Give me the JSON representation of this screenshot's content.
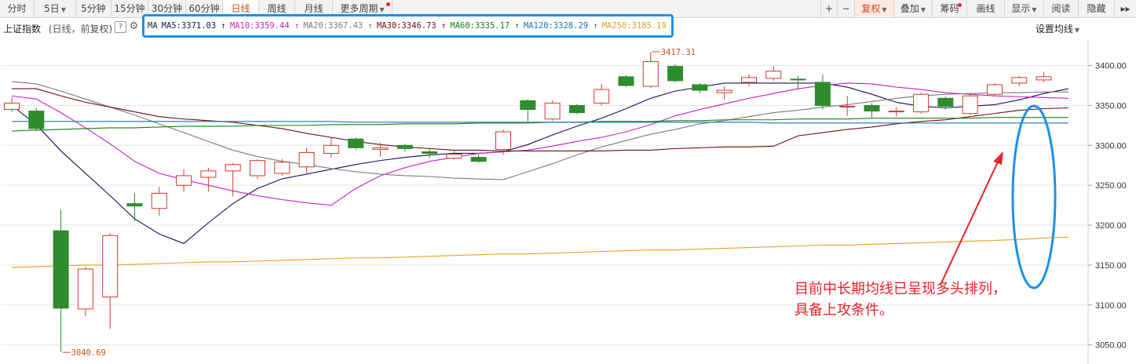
{
  "toolbar": {
    "left_tabs": [
      "分时",
      "5日",
      "5分钟",
      "15分钟",
      "30分钟",
      "60分钟",
      "日线",
      "周线",
      "月线",
      "更多周期"
    ],
    "active_tab": "日线",
    "right_tabs": [
      "复权",
      "叠加",
      "筹码",
      "画线",
      "显示",
      "阅读",
      "隐藏"
    ],
    "plus": "+",
    "minus": "−",
    "forward": "▸▸",
    "dot_color": "#e8222a"
  },
  "header": {
    "title": "上证指数",
    "subtitle": "(日线，前复权)",
    "help_icon": "?",
    "settings_icon": "gear-icon",
    "set_ma_label": "设置均线"
  },
  "ma_legend": {
    "prefix": "MA",
    "items": [
      {
        "label": "MA5:3371.03",
        "arrow": "↑",
        "color": "#14145c"
      },
      {
        "label": "MA10:3359.44",
        "arrow": "↑",
        "color": "#c81ec8"
      },
      {
        "label": "MA20:3367.43",
        "arrow": "↑",
        "color": "#7a7a7a"
      },
      {
        "label": "MA30:3346.73",
        "arrow": "↑",
        "color": "#6e0a14"
      },
      {
        "label": "MA60:3335.17",
        "arrow": "↑",
        "color": "#1a7d1a"
      },
      {
        "label": "MA120:3328.29",
        "arrow": "↑",
        "color": "#1478b4"
      },
      {
        "label": "MA250:3185.19",
        "arrow": "↑",
        "color": "#e8a01e"
      }
    ]
  },
  "annotation": {
    "line1": "目前中长期均线已呈现多头排列，",
    "line2": "具备上攻条件。",
    "color": "#e8222a"
  },
  "chart_data": {
    "type": "candlestick",
    "ylim": [
      3030,
      3433
    ],
    "yticks": [
      "3400.00",
      "3350.00",
      "3300.00",
      "3250.00",
      "3200.00",
      "3150.00",
      "3100.00",
      "3050.00"
    ],
    "grid": true,
    "up_color": "#d43a2e",
    "down_color": "#2e8b2e",
    "candles": [
      {
        "o": 3345,
        "c": 3353,
        "h": 3360,
        "l": 3342
      },
      {
        "o": 3343,
        "c": 3321,
        "h": 3347,
        "l": 3318
      },
      {
        "o": 3193,
        "c": 3096,
        "h": 3219,
        "l": 3041
      },
      {
        "o": 3095,
        "c": 3145,
        "h": 3148,
        "l": 3086
      },
      {
        "o": 3110,
        "c": 3187,
        "h": 3190,
        "l": 3070
      },
      {
        "o": 3227,
        "c": 3224,
        "h": 3240,
        "l": 3205
      },
      {
        "o": 3221,
        "c": 3240,
        "h": 3248,
        "l": 3212
      },
      {
        "o": 3250,
        "c": 3262,
        "h": 3270,
        "l": 3242
      },
      {
        "o": 3260,
        "c": 3268,
        "h": 3272,
        "l": 3242
      },
      {
        "o": 3268,
        "c": 3276,
        "h": 3278,
        "l": 3236
      },
      {
        "o": 3262,
        "c": 3281,
        "h": 3283,
        "l": 3258
      },
      {
        "o": 3265,
        "c": 3279,
        "h": 3283,
        "l": 3262
      },
      {
        "o": 3273,
        "c": 3291,
        "h": 3297,
        "l": 3265
      },
      {
        "o": 3290,
        "c": 3300,
        "h": 3310,
        "l": 3285
      },
      {
        "o": 3308,
        "c": 3297,
        "h": 3310,
        "l": 3294
      },
      {
        "o": 3295,
        "c": 3297,
        "h": 3303,
        "l": 3286
      },
      {
        "o": 3300,
        "c": 3296,
        "h": 3302,
        "l": 3292
      },
      {
        "o": 3292,
        "c": 3290,
        "h": 3296,
        "l": 3284
      },
      {
        "o": 3284,
        "c": 3289,
        "h": 3293,
        "l": 3282
      },
      {
        "o": 3285,
        "c": 3280,
        "h": 3290,
        "l": 3278
      },
      {
        "o": 3295,
        "c": 3317,
        "h": 3320,
        "l": 3288
      },
      {
        "o": 3356,
        "c": 3345,
        "h": 3358,
        "l": 3330
      },
      {
        "o": 3333,
        "c": 3353,
        "h": 3356,
        "l": 3331
      },
      {
        "o": 3350,
        "c": 3341,
        "h": 3352,
        "l": 3339
      },
      {
        "o": 3353,
        "c": 3370,
        "h": 3377,
        "l": 3350
      },
      {
        "o": 3386,
        "c": 3375,
        "h": 3388,
        "l": 3373
      },
      {
        "o": 3374,
        "c": 3405,
        "h": 3417,
        "l": 3372
      },
      {
        "o": 3399,
        "c": 3381,
        "h": 3402,
        "l": 3379
      },
      {
        "o": 3376,
        "c": 3369,
        "h": 3378,
        "l": 3365
      },
      {
        "o": 3366,
        "c": 3369,
        "h": 3374,
        "l": 3357
      },
      {
        "o": 3379,
        "c": 3385,
        "h": 3389,
        "l": 3374
      },
      {
        "o": 3384,
        "c": 3393,
        "h": 3399,
        "l": 3381
      },
      {
        "o": 3383,
        "c": 3382,
        "h": 3387,
        "l": 3370
      },
      {
        "o": 3379,
        "c": 3350,
        "h": 3389,
        "l": 3345
      },
      {
        "o": 3348,
        "c": 3349,
        "h": 3362,
        "l": 3337
      },
      {
        "o": 3350,
        "c": 3343,
        "h": 3353,
        "l": 3335
      },
      {
        "o": 3342,
        "c": 3343,
        "h": 3348,
        "l": 3336
      },
      {
        "o": 3342,
        "c": 3364,
        "h": 3366,
        "l": 3340
      },
      {
        "o": 3359,
        "c": 3349,
        "h": 3361,
        "l": 3345
      },
      {
        "o": 3340,
        "c": 3362,
        "h": 3364,
        "l": 3338
      },
      {
        "o": 3364,
        "c": 3376,
        "h": 3378,
        "l": 3362
      },
      {
        "o": 3378,
        "c": 3385,
        "h": 3387,
        "l": 3374
      },
      {
        "o": 3382,
        "c": 3386,
        "h": 3392,
        "l": 3379
      }
    ],
    "price_labels": [
      {
        "text": "3417.31",
        "index": 26,
        "value": 3417.31
      },
      {
        "text": "3040.69",
        "index": 2,
        "value": 3040.69
      }
    ],
    "series": [
      {
        "name": "MA5",
        "color": "#14145c",
        "values": [
          3350,
          3326,
          3293,
          3265,
          3237,
          3208,
          3189,
          3177,
          3203,
          3227,
          3246,
          3258,
          3264,
          3270,
          3276,
          3281,
          3285,
          3288,
          3290,
          3290,
          3292,
          3301,
          3313,
          3324,
          3334,
          3346,
          3359,
          3368,
          3373,
          3378,
          3378,
          3378,
          3378,
          3378,
          3373,
          3364,
          3354,
          3349,
          3347,
          3349,
          3351,
          3357,
          3365,
          3371
        ]
      },
      {
        "name": "MA10",
        "color": "#c81ec8",
        "values": [
          3362,
          3358,
          3341,
          3322,
          3302,
          3280,
          3265,
          3257,
          3250,
          3243,
          3237,
          3232,
          3228,
          3225,
          3246,
          3262,
          3272,
          3280,
          3285,
          3290,
          3292,
          3294,
          3299,
          3305,
          3310,
          3317,
          3326,
          3337,
          3345,
          3352,
          3359,
          3365,
          3371,
          3375,
          3378,
          3377,
          3373,
          3370,
          3366,
          3364,
          3362,
          3361,
          3360,
          3359
        ]
      },
      {
        "name": "MA20",
        "color": "#7a7a7a",
        "values": [
          3380,
          3377,
          3368,
          3358,
          3348,
          3338,
          3327,
          3316,
          3305,
          3294,
          3286,
          3280,
          3276,
          3271,
          3267,
          3264,
          3262,
          3261,
          3259,
          3258,
          3257,
          3267,
          3277,
          3288,
          3298,
          3306,
          3314,
          3320,
          3327,
          3331,
          3336,
          3341,
          3344,
          3348,
          3351,
          3355,
          3359,
          3362,
          3364,
          3365,
          3366,
          3366,
          3367,
          3367
        ]
      },
      {
        "name": "MA30",
        "color": "#6e0a14",
        "values": [
          3371,
          3371,
          3362,
          3354,
          3348,
          3342,
          3336,
          3333,
          3331,
          3329,
          3325,
          3321,
          3315,
          3310,
          3305,
          3301,
          3298,
          3296,
          3294,
          3294,
          3293,
          3293,
          3293,
          3293,
          3293,
          3294,
          3294,
          3296,
          3297,
          3298,
          3298,
          3299,
          3312,
          3316,
          3320,
          3323,
          3327,
          3330,
          3332,
          3336,
          3340,
          3344,
          3346,
          3347
        ]
      },
      {
        "name": "MA60",
        "color": "#1a7d1a",
        "values": [
          3318,
          3319,
          3320,
          3321,
          3322,
          3322,
          3323,
          3324,
          3324,
          3324,
          3325,
          3325,
          3325,
          3326,
          3326,
          3326,
          3327,
          3327,
          3327,
          3328,
          3328,
          3328,
          3329,
          3329,
          3330,
          3330,
          3330,
          3331,
          3331,
          3332,
          3332,
          3332,
          3333,
          3333,
          3333,
          3334,
          3334,
          3334,
          3334,
          3334,
          3335,
          3335,
          3335,
          3335
        ]
      },
      {
        "name": "MA120",
        "color": "#1478b4",
        "values": [
          3330,
          3330,
          3330,
          3330,
          3330,
          3330,
          3330,
          3330,
          3330,
          3330,
          3330,
          3330,
          3330,
          3330,
          3329,
          3329,
          3329,
          3329,
          3329,
          3329,
          3329,
          3329,
          3329,
          3329,
          3329,
          3329,
          3329,
          3329,
          3329,
          3329,
          3329,
          3328,
          3328,
          3328,
          3328,
          3328,
          3328,
          3328,
          3328,
          3328,
          3328,
          3328,
          3328,
          3328
        ]
      },
      {
        "name": "MA250",
        "color": "#e8a01e",
        "values": [
          3147,
          3148,
          3149,
          3150,
          3150,
          3151,
          3152,
          3153,
          3154,
          3154,
          3155,
          3156,
          3157,
          3158,
          3159,
          3159,
          3160,
          3161,
          3162,
          3163,
          3164,
          3164,
          3165,
          3166,
          3167,
          3168,
          3169,
          3169,
          3170,
          3171,
          3172,
          3173,
          3174,
          3175,
          3175,
          3176,
          3177,
          3178,
          3179,
          3180,
          3181,
          3182,
          3184,
          3185
        ]
      }
    ]
  }
}
